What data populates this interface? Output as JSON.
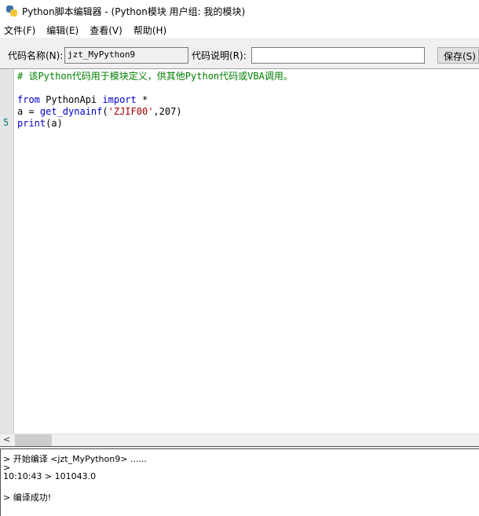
{
  "window": {
    "title": "Python脚本编辑器 - (Python模块 用户组: 我的模块)"
  },
  "menu": [
    "文件(F)",
    "编辑(E)",
    "查看(V)",
    "帮助(H)"
  ],
  "toolbar": {
    "name_label": "代码名称(N):",
    "name_value": "jzt_MyPython9",
    "desc_label": "代码说明(R):",
    "desc_value": "",
    "save_label": "保存(S)"
  },
  "editor": {
    "line_marker": "5",
    "comment": "# 该Python代码用于模块定义，供其他Python代码或VBA调用。",
    "line3": {
      "kw1": "from",
      "mod": " PythonApi ",
      "kw2": "import",
      "rest": " *"
    },
    "line4": {
      "pre": "a = ",
      "fn": "get_dynainf",
      "p1": "(",
      "str": "'ZJIF00'",
      "rest": ",207)"
    },
    "line5": {
      "fn": "print",
      "rest": "(a)"
    }
  },
  "scrollbar": {
    "left_arrow": "<"
  },
  "output": [
    "> 开始编译 <jzt_MyPython9> ......",
    ">",
    "10:10:43 > 101043.0",
    "> 编译成功!"
  ]
}
